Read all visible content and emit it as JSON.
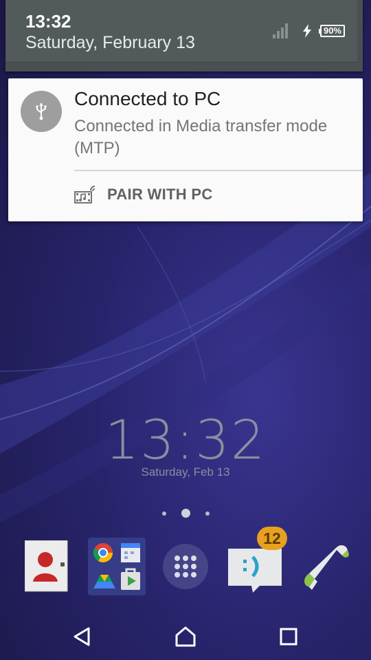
{
  "status": {
    "time": "13:32",
    "date": "Saturday, February 13",
    "battery_percent": "90%",
    "icons": [
      "signal-icon",
      "charging-bolt-icon",
      "battery-icon"
    ]
  },
  "notification": {
    "app_icon": "usb-icon",
    "title": "Connected to PC",
    "text": "Connected in Media transfer mode (MTP)",
    "action_icon": "media-pair-icon",
    "action_label": "PAIR WITH PC"
  },
  "clock_widget": {
    "time": "13:32",
    "date": "Saturday, Feb 13"
  },
  "page_indicator": {
    "pages": 3,
    "current": 2
  },
  "dock": {
    "apps": [
      "contacts-icon",
      "google-folder-icon",
      "app-drawer-icon",
      "messaging-icon",
      "phone-icon"
    ],
    "messaging_badge": "12"
  },
  "navigation": {
    "buttons": [
      "back-icon",
      "home-icon",
      "recents-icon"
    ]
  },
  "colors": {
    "wallpaper": "#28246c",
    "badge": "#e8a020",
    "notification_bg": "#fafafa"
  }
}
